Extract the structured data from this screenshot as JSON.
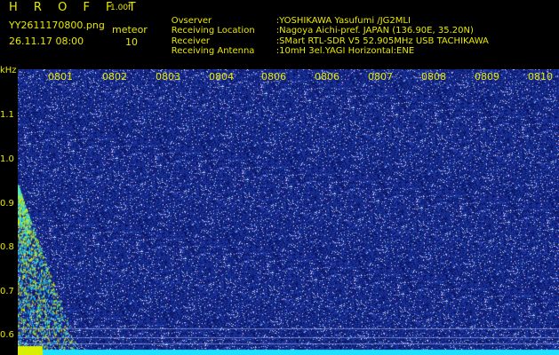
{
  "app": {
    "title_letters": "H R O F F T",
    "version": "1.00f",
    "filename": "YY2611170800.png",
    "datetime": "26.11.17 08:00",
    "meteor_label": "meteor",
    "meteor_count": "10"
  },
  "station": [
    {
      "key": "Ovserver",
      "value": ":YOSHIKAWA Yasufumi /JG2MLI"
    },
    {
      "key": "Receiving Location",
      "value": ":Nagoya Aichi-pref. JAPAN (136.90E, 35.20N)"
    },
    {
      "key": "Receiver",
      "value": ":SMart RTL-SDR V5 52.905MHz USB TACHIKAWA"
    },
    {
      "key": "Receiving Antenna",
      "value": ":10mH 3el.YAGI Horizontal:ENE"
    }
  ],
  "spectrogram": {
    "y_unit": "kHz",
    "y_ticks": [
      "1.1",
      "1.0",
      "0.9",
      "0.8",
      "0.7",
      "0.6"
    ],
    "x_ticks": [
      "0801",
      "0802",
      "0803",
      "0804",
      "0806",
      "0806",
      "0807",
      "0808",
      "0809",
      "0810"
    ],
    "colors": {
      "background": "#0a1670",
      "noise": "#3a5ae0",
      "signal": "#22e0ff",
      "meteor": "#d8f000",
      "label": "#e8e800"
    }
  }
}
